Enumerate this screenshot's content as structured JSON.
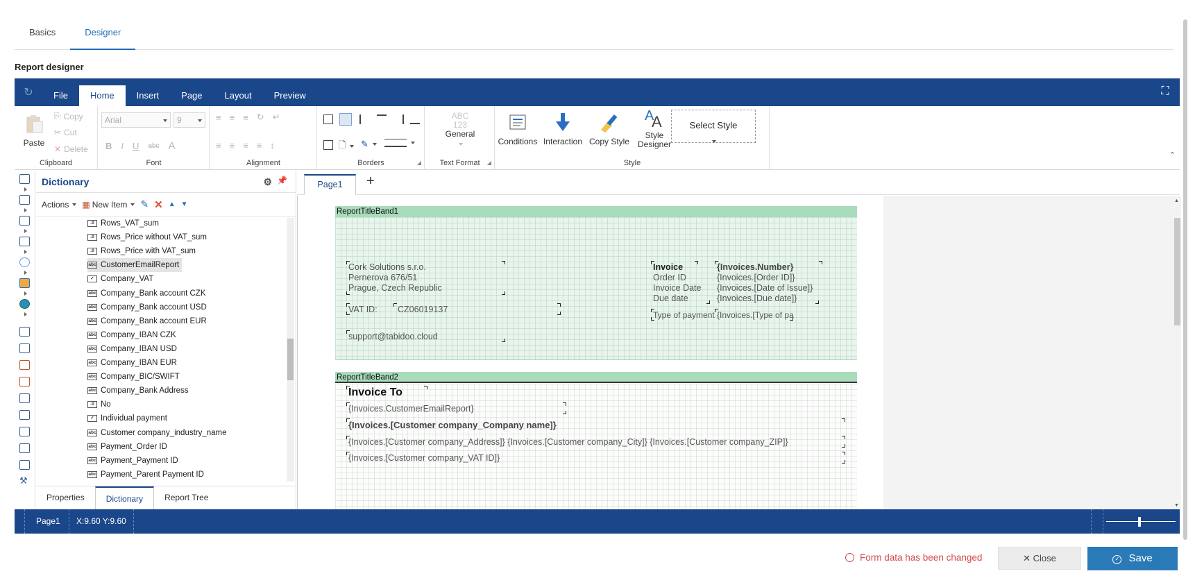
{
  "top_tabs": {
    "basics": "Basics",
    "designer": "Designer"
  },
  "section_title": "Report designer",
  "ribbon": {
    "tabs": [
      "File",
      "Home",
      "Insert",
      "Page",
      "Layout",
      "Preview"
    ],
    "active_tab": "Home",
    "clipboard": {
      "paste": "Paste",
      "copy": "Copy",
      "cut": "Cut",
      "delete": "Delete",
      "label": "Clipboard"
    },
    "font": {
      "family": "Arial",
      "size": "9",
      "label": "Font",
      "bold": "B",
      "italic": "I",
      "underline": "U",
      "strike": "abc",
      "grow": "A"
    },
    "alignment": {
      "label": "Alignment"
    },
    "borders": {
      "label": "Borders"
    },
    "text_format": {
      "sample": "ABC\n123",
      "value": "General",
      "label": "Text Format"
    },
    "style": {
      "conditions": "Conditions",
      "interaction": "Interaction",
      "copy_style": "Copy Style",
      "style_designer_1": "Style",
      "style_designer_2": "Designer",
      "select_style": "Select Style",
      "label": "Style"
    }
  },
  "dictionary": {
    "title": "Dictionary",
    "actions": "Actions",
    "new_item": "New Item",
    "items": [
      {
        "type": "num",
        "label": "Rows_VAT_sum"
      },
      {
        "type": "num",
        "label": "Rows_Price without VAT_sum"
      },
      {
        "type": "num",
        "label": "Rows_Price with VAT_sum"
      },
      {
        "type": "abc",
        "label": "CustomerEmailReport",
        "selected": true
      },
      {
        "type": "chk",
        "label": "Company_VAT"
      },
      {
        "type": "abc",
        "label": "Company_Bank account CZK"
      },
      {
        "type": "abc",
        "label": "Company_Bank account USD"
      },
      {
        "type": "abc",
        "label": "Company_Bank account EUR"
      },
      {
        "type": "abc",
        "label": "Company_IBAN CZK"
      },
      {
        "type": "abc",
        "label": "Company_IBAN USD"
      },
      {
        "type": "abc",
        "label": "Company_IBAN EUR"
      },
      {
        "type": "abc",
        "label": "Company_BIC/SWIFT"
      },
      {
        "type": "abc",
        "label": "Company_Bank Address"
      },
      {
        "type": "num",
        "label": "No"
      },
      {
        "type": "chk",
        "label": "Individual payment"
      },
      {
        "type": "abc",
        "label": "Customer company_industry_name"
      },
      {
        "type": "abc",
        "label": "Payment_Order ID"
      },
      {
        "type": "abc",
        "label": "Payment_Payment ID"
      },
      {
        "type": "abc",
        "label": "Payment_Parent Payment ID"
      }
    ],
    "bottom_tabs": [
      "Properties",
      "Dictionary",
      "Report Tree"
    ]
  },
  "page_tab": "Page1",
  "report": {
    "band1": {
      "title": "ReportTitleBand1",
      "company_line1": "Cork Solutions s.r.o.",
      "company_line2": "Pernerova 676/51",
      "company_line3": "Prague, Czech Republic",
      "vat_label": "VAT ID:",
      "vat_value": "CZ06019137",
      "email": "support@tabidoo.cloud",
      "invoice_label": "Invoice",
      "order_label": "Order ID",
      "invoice_date_label": "Invoice Date",
      "due_label": "Due date",
      "payment_label": "Type of payment",
      "invoice_number": "{Invoices.Number}",
      "order_value": "{Invoices.[Order ID]}",
      "date_value": "{Invoices.[Date of Issue]}",
      "due_value": "{Invoices.[Due date]}",
      "payment_value": "{Invoices.[Type of pa"
    },
    "band2": {
      "title": "ReportTitleBand2",
      "invoice_to": "Invoice To",
      "customer_email": "{Invoices.CustomerEmailReport}",
      "company_name": "{Invoices.[Customer company_Company name]}",
      "address": "{Invoices.[Customer company_Address]} {Invoices.[Customer company_City]} {Invoices.[Customer company_ZIP]}",
      "vat_id": "{Invoices.[Customer company_VAT ID]}"
    }
  },
  "status": {
    "page": "Page1",
    "coords": "X:9.60 Y:9.60"
  },
  "footer": {
    "message": "Form data has been changed",
    "close": "Close",
    "save": "Save"
  }
}
